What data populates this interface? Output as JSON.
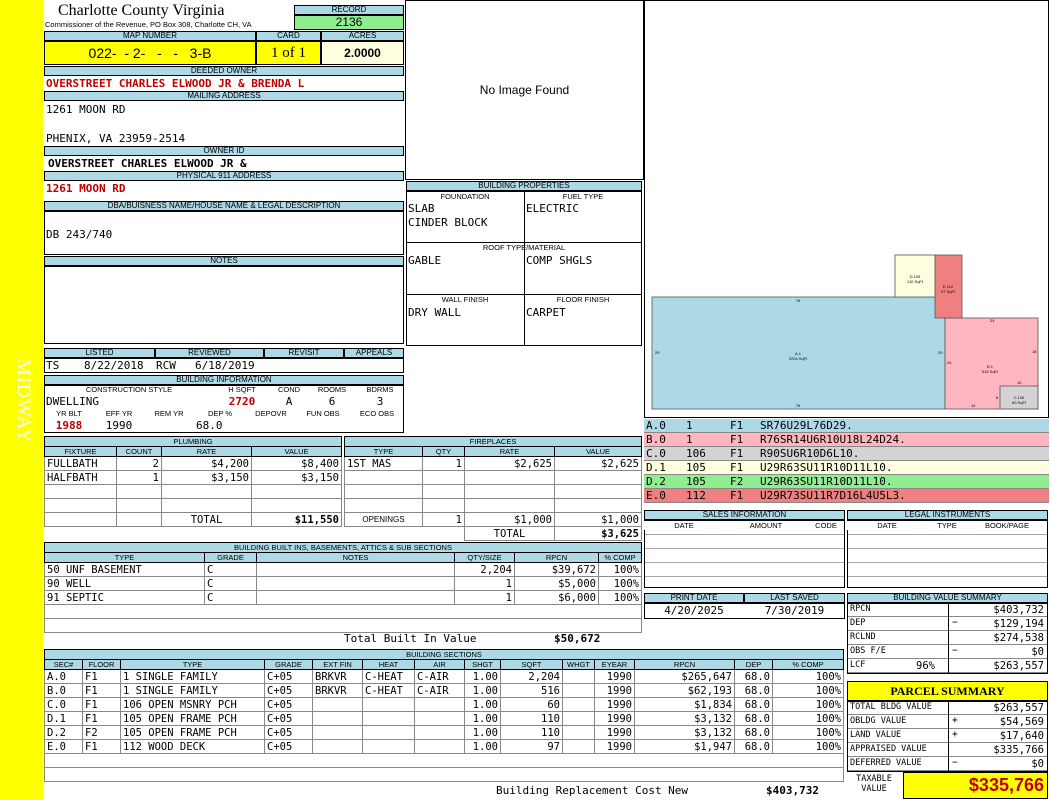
{
  "sidebar_label": "MIDWAY",
  "county": {
    "title": "Charlotte County Virginia",
    "address": "Commissioner of the Revenue, PO Box 308, Charlotte CH, VA"
  },
  "record": {
    "label": "RECORD",
    "value": "2136"
  },
  "map": {
    "label": "MAP NUMBER",
    "value": "022-  - 2-   -   -   3-B"
  },
  "card": {
    "label": "CARD",
    "value": "1 of 1"
  },
  "acres": {
    "label": "ACRES",
    "value": "2.0000"
  },
  "deeded_owner": {
    "label": "DEEDED OWNER",
    "value": "OVERSTREET CHARLES ELWOOD JR & BRENDA L"
  },
  "mailing": {
    "label": "MAILING ADDRESS",
    "line1": "1261 MOON RD",
    "line2": "PHENIX, VA 23959-2514"
  },
  "owner_id": {
    "label": "OWNER ID",
    "value": "OVERSTREET CHARLES ELWOOD JR &"
  },
  "physical": {
    "label": "PHYSICAL 911 ADDRESS",
    "value": "1261 MOON RD"
  },
  "legal": {
    "label": "DBA/BUISNESS NAME/HOUSE NAME & LEGAL DESCRIPTION",
    "value": "DB 243/740"
  },
  "notes": {
    "label": "NOTES",
    "value": ""
  },
  "no_image": "No Image Found",
  "listing": {
    "labels": [
      "LISTED",
      "REVIEWED",
      "REVISIT",
      "APPEALS"
    ],
    "listed_by": "TS",
    "listed_date": "8/22/2018",
    "reviewed_by": "RCW",
    "reviewed_date": "6/18/2019"
  },
  "building_info": {
    "label": "BUILDING INFORMATION",
    "headers": [
      "CONSTRUCTION STYLE",
      "H SQFT",
      "COND",
      "ROOMS",
      "BDRMS"
    ],
    "style": "DWELLING",
    "hsqft": "2720",
    "cond": "A",
    "rooms": "6",
    "bdrms": "3",
    "headers2": [
      "YR BLT",
      "EFF YR",
      "REM YR",
      "DEP %",
      "DEPOVR",
      "FUN OBS",
      "ECO OBS"
    ],
    "yr_blt": "1988",
    "eff_yr": "1990",
    "rem_yr": "",
    "dep": "68.0"
  },
  "building_props": {
    "label": "BUILDING PROPERTIES",
    "foundation_label": "FOUNDATION",
    "fuel_label": "FUEL TYPE",
    "foundation": [
      "SLAB",
      "CINDER BLOCK"
    ],
    "fuel": "ELECTRIC",
    "roof_label": "ROOF TYPE/MATERIAL",
    "roof_type": "GABLE",
    "roof_mat": "COMP SHGLS",
    "wall_label": "WALL FINISH",
    "floor_label": "FLOOR FINISH",
    "wall": "DRY WALL",
    "floor": "CARPET"
  },
  "plumbing": {
    "label": "PLUMBING",
    "headers": [
      "FIXTURE",
      "COUNT",
      "RATE",
      "VALUE"
    ],
    "rows": [
      [
        "FULLBATH",
        "2",
        "$4,200",
        "$8,400"
      ],
      [
        "HALFBATH",
        "1",
        "$3,150",
        "$3,150"
      ]
    ],
    "total_label": "TOTAL",
    "total": "$11,550"
  },
  "fireplaces": {
    "label": "FIREPLACES",
    "headers": [
      "TYPE",
      "QTY",
      "RATE",
      "VALUE"
    ],
    "rows": [
      [
        "1ST MAS",
        "1",
        "$2,625",
        "$2,625"
      ]
    ],
    "openings_label": "OPENINGS",
    "openings": [
      "1",
      "$1,000",
      "$1,000"
    ],
    "total_label": "TOTAL",
    "total": "$3,625"
  },
  "builtins": {
    "label": "BUILDING BUILT INS, BASEMENTS, ATTICS & SUB SECTIONS",
    "headers": [
      "TYPE",
      "GRADE",
      "NOTES",
      "QTY/SIZE",
      "RPCN",
      "% COMP"
    ],
    "rows": [
      [
        "50 UNF BASEMENT",
        "C",
        "",
        "2,204",
        "$39,672",
        "100%"
      ],
      [
        "90 WELL",
        "C",
        "",
        "1",
        "$5,000",
        "100%"
      ],
      [
        "91 SEPTIC",
        "C",
        "",
        "1",
        "$6,000",
        "100%"
      ]
    ],
    "total_label": "Total Built In Value",
    "total": "$50,672"
  },
  "sections": {
    "label": "BUILDING SECTIONS",
    "headers": [
      "SEC#",
      "FLOOR",
      "TYPE",
      "GRADE",
      "EXT FIN",
      "HEAT",
      "AIR",
      "SHGT",
      "SQFT",
      "WHGT",
      "EYEAR",
      "RPCN",
      "DEP",
      "% COMP"
    ],
    "rows": [
      [
        "A.0",
        "F1",
        "1 SINGLE FAMILY",
        "C+05",
        "BRKVR",
        "C-HEAT",
        "C-AIR",
        "1.00",
        "2,204",
        "",
        "1990",
        "$265,647",
        "68.0",
        "100%"
      ],
      [
        "B.0",
        "F1",
        "1 SINGLE FAMILY",
        "C+05",
        "BRKVR",
        "C-HEAT",
        "C-AIR",
        "1.00",
        "516",
        "",
        "1990",
        "$62,193",
        "68.0",
        "100%"
      ],
      [
        "C.0",
        "F1",
        "106 OPEN MSNRY PCH",
        "C+05",
        "",
        "",
        "",
        "1.00",
        "60",
        "",
        "1990",
        "$1,834",
        "68.0",
        "100%"
      ],
      [
        "D.1",
        "F1",
        "105 OPEN FRAME PCH",
        "C+05",
        "",
        "",
        "",
        "1.00",
        "110",
        "",
        "1990",
        "$3,132",
        "68.0",
        "100%"
      ],
      [
        "D.2",
        "F2",
        "105 OPEN FRAME PCH",
        "C+05",
        "",
        "",
        "",
        "1.00",
        "110",
        "",
        "1990",
        "$3,132",
        "68.0",
        "100%"
      ],
      [
        "E.0",
        "F1",
        "112 WOOD DECK",
        "C+05",
        "",
        "",
        "",
        "1.00",
        "97",
        "",
        "1990",
        "$1,947",
        "68.0",
        "100%"
      ]
    ],
    "total_label": "Building Replacement Cost New",
    "total": "$403,732"
  },
  "sketch": {
    "labels": [
      "A.1\n2204 SqFt",
      "B.1\n516 SqFt",
      "C.106\n60 SqFt",
      "D.105\n110 SqFt",
      "E.112\n97 SqFt"
    ],
    "dims": [
      "76",
      "76",
      "29",
      "29",
      "14",
      "24",
      "18",
      "10",
      "6",
      "14"
    ],
    "colors": {
      "A": "#add8e6",
      "B": "#ffb6c1",
      "C": "#d3d3d3",
      "D": "#ffffe0",
      "E": "#f08080"
    }
  },
  "legend": [
    {
      "sec": "A.0",
      "num": "1",
      "floor": "F1",
      "code": "SR76U29L76D29.",
      "color": "#add8e6"
    },
    {
      "sec": "B.0",
      "num": "1",
      "floor": "F1",
      "code": "R76SR14U6R10U18L24D24.",
      "color": "#ffb6c1"
    },
    {
      "sec": "C.0",
      "num": "106",
      "floor": "F1",
      "code": "R90SU6R10D6L10.",
      "color": "#d3d3d3"
    },
    {
      "sec": "D.1",
      "num": "105",
      "floor": "F1",
      "code": "U29R63SU11R10D11L10.",
      "color": "#ffffe0"
    },
    {
      "sec": "D.2",
      "num": "105",
      "floor": "F2",
      "code": "U29R63SU11R10D11L10.",
      "color": "#90ee90"
    },
    {
      "sec": "E.0",
      "num": "112",
      "floor": "F1",
      "code": "U29R73SU11R7D16L4U5L3.",
      "color": "#f08080"
    }
  ],
  "sales": {
    "label": "SALES INFORMATION",
    "headers": [
      "DATE",
      "AMOUNT",
      "CODE"
    ]
  },
  "legal_instruments": {
    "label": "LEGAL INSTRUMENTS",
    "headers": [
      "DATE",
      "TYPE",
      "BOOK/PAGE"
    ]
  },
  "print_date": {
    "label": "PRINT DATE",
    "value": "4/20/2025"
  },
  "last_saved": {
    "label": "LAST SAVED",
    "value": "7/30/2019"
  },
  "value_summary": {
    "label": "BUILDING VALUE SUMMARY",
    "rows": [
      {
        "k": "RPCN",
        "pct": "",
        "sign": "",
        "v": "$403,732"
      },
      {
        "k": "DEP",
        "pct": "",
        "sign": "−",
        "v": "$129,194"
      },
      {
        "k": "RCLND",
        "pct": "",
        "sign": "",
        "v": "$274,538"
      },
      {
        "k": "OBS F/E",
        "pct": "",
        "sign": "−",
        "v": "$0"
      },
      {
        "k": "LCF",
        "pct": "96%",
        "sign": "",
        "v": "$263,557"
      }
    ]
  },
  "parcel_summary": {
    "label": "PARCEL SUMMARY",
    "rows": [
      {
        "k": "TOTAL BLDG VALUE",
        "sign": "",
        "v": "$263,557"
      },
      {
        "k": "OBLDG VALUE",
        "sign": "+",
        "v": "$54,569"
      },
      {
        "k": "LAND VALUE",
        "sign": "+",
        "v": "$17,640"
      },
      {
        "k": "APPRAISED VALUE",
        "sign": "",
        "v": "$335,766"
      },
      {
        "k": "DEFERRED VALUE",
        "sign": "−",
        "v": "$0"
      }
    ],
    "taxable_label": "TAXABLE VALUE",
    "taxable": "$335,766"
  }
}
